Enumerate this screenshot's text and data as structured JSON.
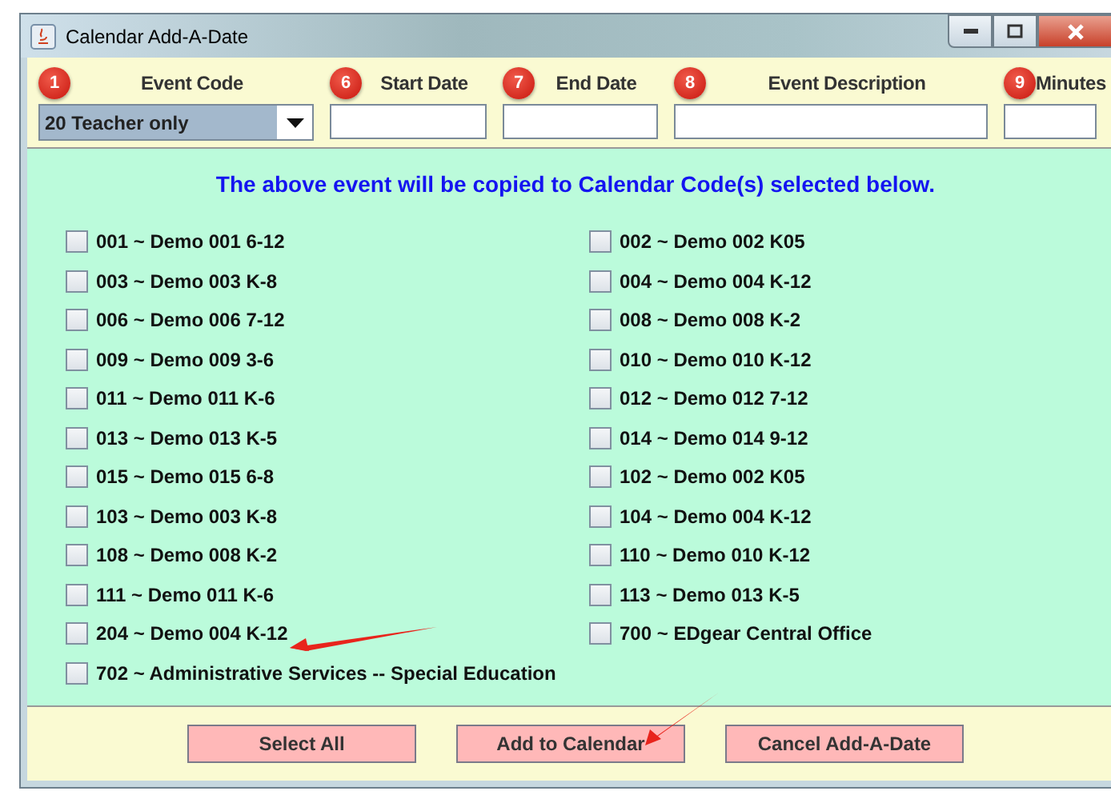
{
  "window": {
    "title": "Calendar Add-A-Date"
  },
  "fields": [
    {
      "badge": "1",
      "label": "Event Code",
      "kind": "dropdown",
      "value": "20 Teacher only"
    },
    {
      "badge": "6",
      "label": "Start Date",
      "kind": "text"
    },
    {
      "badge": "7",
      "label": "End Date",
      "kind": "text"
    },
    {
      "badge": "8",
      "label": "Event Description",
      "kind": "text"
    },
    {
      "badge": "9",
      "label": "Minutes",
      "kind": "text"
    }
  ],
  "notice": "The above event will be copied to Calendar Code(s) selected below.",
  "calendar_codes": [
    {
      "label": "001 ~ Demo 001 6-12",
      "checked": false
    },
    {
      "label": "002 ~ Demo 002 K05",
      "checked": false
    },
    {
      "label": "003 ~ Demo 003 K-8",
      "checked": false
    },
    {
      "label": "004 ~ Demo 004 K-12",
      "checked": false
    },
    {
      "label": "006 ~ Demo 006 7-12",
      "checked": false
    },
    {
      "label": "008 ~ Demo 008 K-2",
      "checked": false
    },
    {
      "label": "009 ~ Demo 009 3-6",
      "checked": false
    },
    {
      "label": "010 ~ Demo 010 K-12",
      "checked": false
    },
    {
      "label": "011 ~ Demo 011 K-6",
      "checked": false
    },
    {
      "label": "012 ~ Demo 012 7-12",
      "checked": false
    },
    {
      "label": "013 ~ Demo 013 K-5",
      "checked": false
    },
    {
      "label": "014 ~ Demo 014 9-12",
      "checked": false
    },
    {
      "label": "015 ~ Demo 015 6-8",
      "checked": false
    },
    {
      "label": "102 ~ Demo 002 K05",
      "checked": false
    },
    {
      "label": "103 ~ Demo 003 K-8",
      "checked": false
    },
    {
      "label": "104 ~ Demo 004 K-12",
      "checked": false
    },
    {
      "label": "108 ~ Demo 008 K-2",
      "checked": false
    },
    {
      "label": "110 ~ Demo 010 K-12",
      "checked": false
    },
    {
      "label": "111 ~ Demo 011 K-6",
      "checked": false
    },
    {
      "label": "113 ~ Demo 013 K-5",
      "checked": false
    },
    {
      "label": "204 ~ Demo 004 K-12",
      "checked": false
    },
    {
      "label": "700 ~ EDgear Central Office",
      "checked": false
    },
    {
      "label": "702 ~ Administrative Services -- Special Education",
      "checked": false
    }
  ],
  "buttons": [
    {
      "label": "Select All"
    },
    {
      "label": "Add to Calendar"
    },
    {
      "label": "Cancel Add-A-Date"
    }
  ]
}
